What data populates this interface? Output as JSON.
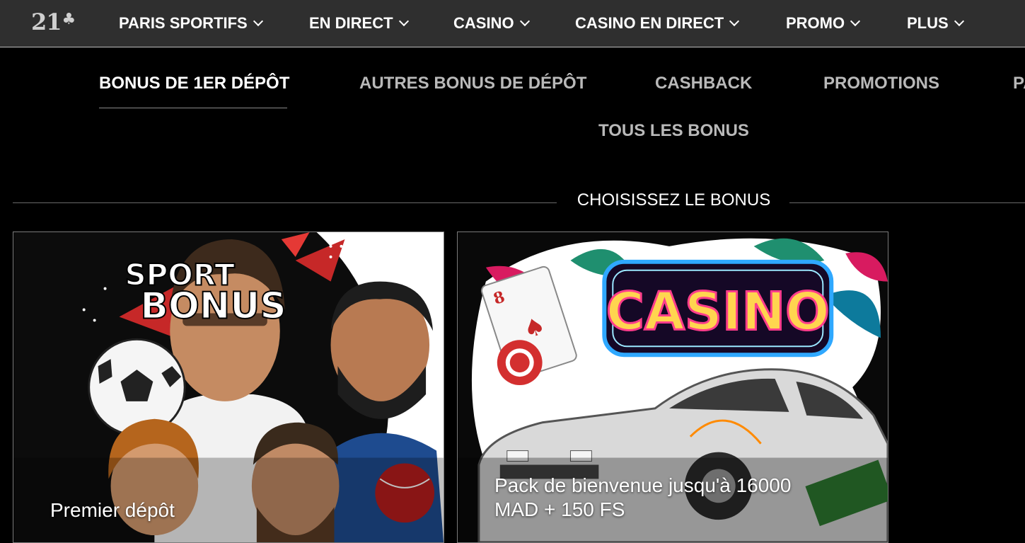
{
  "logo": {
    "text": "21",
    "mark": "♣"
  },
  "nav": [
    {
      "label": "PARIS SPORTIFS",
      "icon": "chevron-down-icon"
    },
    {
      "label": "EN DIRECT",
      "icon": "chevron-down-icon"
    },
    {
      "label": "CASINO",
      "icon": "chevron-down-icon"
    },
    {
      "label": "CASINO EN DIRECT",
      "icon": "chevron-down-icon"
    },
    {
      "label": "PROMO",
      "icon": "chevron-down-icon"
    },
    {
      "label": "PLUS",
      "icon": "chevron-down-icon"
    }
  ],
  "tabs": [
    {
      "label": "BONUS DE 1ER DÉPÔT",
      "active": true
    },
    {
      "label": "AUTRES BONUS DE DÉPÔT",
      "active": false
    },
    {
      "label": "CASHBACK",
      "active": false
    },
    {
      "label": "PROMOTIONS",
      "active": false
    },
    {
      "label": "PA",
      "active": false
    },
    {
      "label": "TOUS LES BONUS",
      "active": false
    }
  ],
  "section": {
    "title": "CHOISISSEZ LE BONUS"
  },
  "cards": [
    {
      "caption": "Premier dépôt",
      "art_text_1": "SPORT",
      "art_text_2": "BONUS"
    },
    {
      "caption_line_1": "Pack de bienvenue jusqu'à 16000",
      "caption_line_2": "MAD + 150 FS",
      "art_text": "CASINO"
    }
  ],
  "colors": {
    "topbar_bg": "#2f2f2f",
    "page_bg": "#000000",
    "tab_inactive": "#b9b9b9",
    "tab_active": "#ffffff",
    "neon_pink": "#ff3d8b",
    "neon_blue": "#2fa8ff"
  }
}
